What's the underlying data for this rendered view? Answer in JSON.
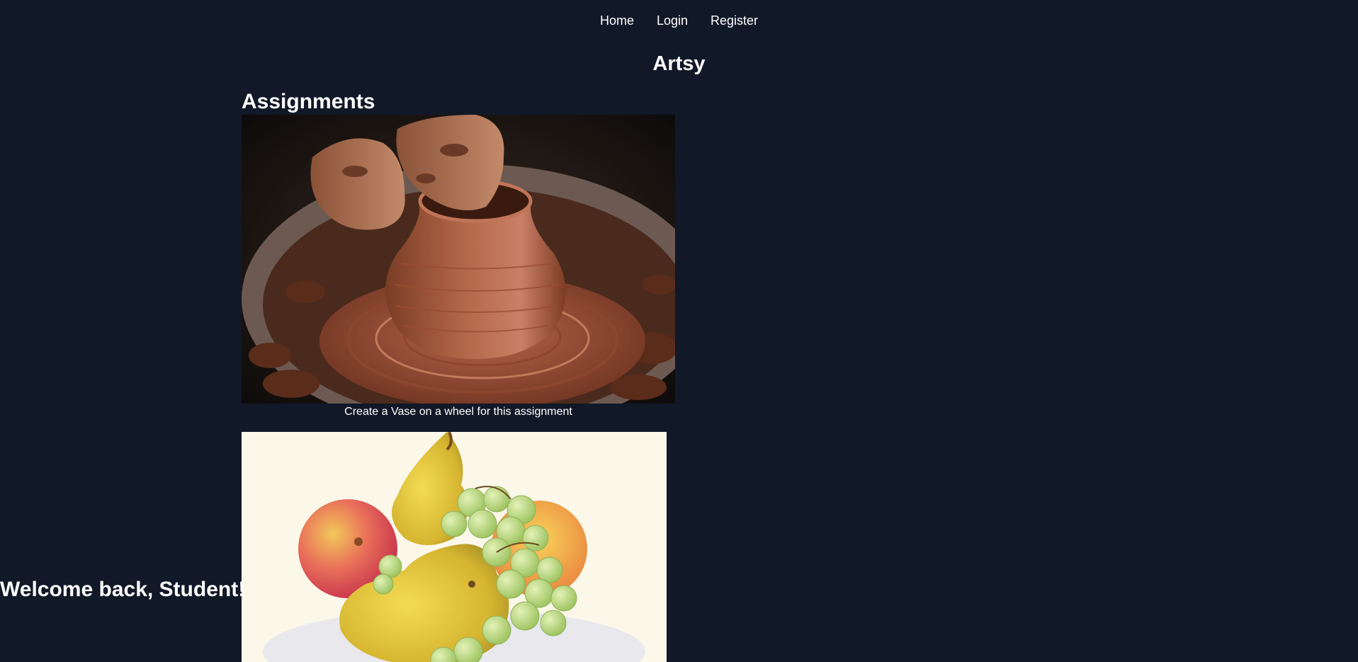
{
  "nav": {
    "items": [
      {
        "label": "Home"
      },
      {
        "label": "Login"
      },
      {
        "label": "Register"
      }
    ]
  },
  "brand": {
    "title": "Artsy"
  },
  "welcome": {
    "text": "Welcome back, Student!"
  },
  "assignments": {
    "heading": "Assignments",
    "items": [
      {
        "image": "pottery-wheel-vase-image",
        "caption": "Create a Vase on a wheel for this assignment"
      },
      {
        "image": "watercolor-fruit-bowl-image"
      }
    ]
  },
  "colors": {
    "background": "#111827",
    "text": "#ffffff"
  }
}
